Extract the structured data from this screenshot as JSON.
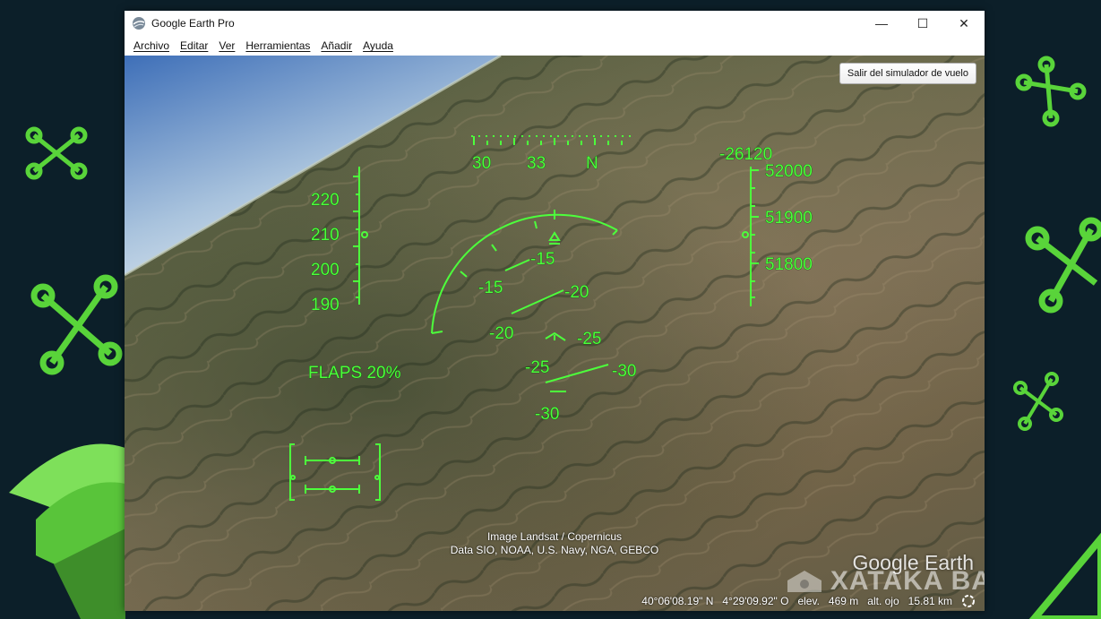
{
  "window": {
    "title": "Google Earth Pro",
    "controls": {
      "minimize": "—",
      "maximize": "☐",
      "close": "✕"
    }
  },
  "menu": [
    "Archivo",
    "Editar",
    "Ver",
    "Herramientas",
    "Añadir",
    "Ayuda"
  ],
  "exit_button": "Salir del simulador de vuelo",
  "hud": {
    "heading": {
      "labels": [
        "30",
        "33",
        "N"
      ]
    },
    "airspeed": {
      "labels": [
        "220",
        "210",
        "200",
        "190"
      ]
    },
    "altitude": {
      "vertical_speed": "-26120",
      "labels": [
        "52000",
        "51900",
        "51800"
      ]
    },
    "pitch_ladder": {
      "left": [
        "-15",
        "-20",
        "-25",
        "-30"
      ],
      "right": [
        "-15",
        "-20",
        "-25",
        "-30"
      ]
    },
    "flaps": "FLAPS 20%",
    "color": "#4dff3c"
  },
  "attribution": [
    "Image Landsat / Copernicus",
    "Data SIO, NOAA, U.S. Navy, NGA, GEBCO"
  ],
  "logo": "Google Earth",
  "watermark": "XATAKA BASICS",
  "status": {
    "lat": "40°06'08.19\" N",
    "lon": "4°29'09.92\" O",
    "elev_label": "elev.",
    "elev_value": "469 m",
    "eye_label": "alt. ojo",
    "eye_value": "15.81 km"
  }
}
